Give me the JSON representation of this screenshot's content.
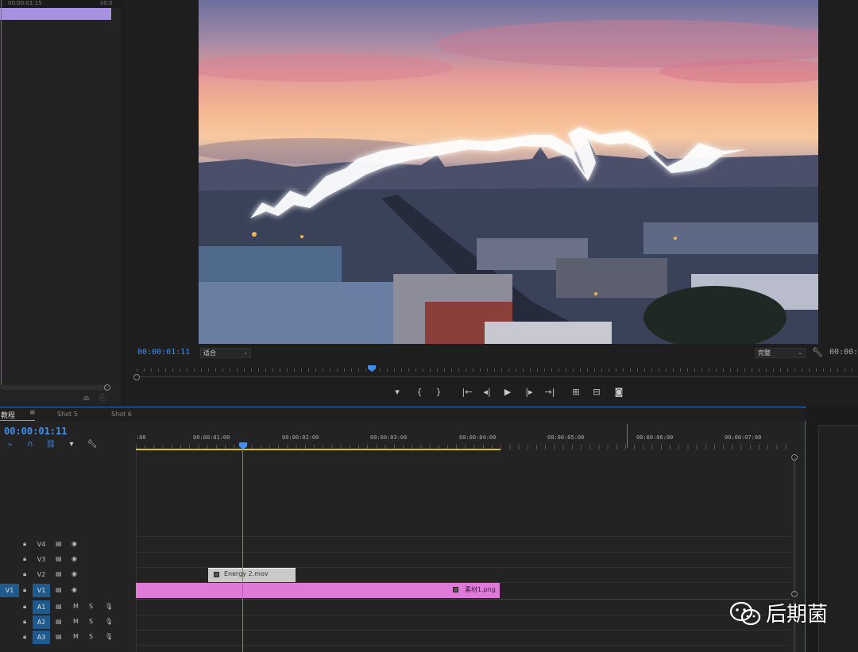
{
  "source_monitor": {
    "ruler_left": "00:00:01:15",
    "ruler_right": "00:0"
  },
  "program": {
    "timecode": "00:00:01:11",
    "fit_value": "适合",
    "quality_value": "完整",
    "duration": "00:00:",
    "transport": [
      {
        "name": "add-marker",
        "glyph": "▾"
      },
      {
        "name": "mark-in",
        "glyph": "{"
      },
      {
        "name": "mark-out",
        "glyph": "}"
      },
      {
        "name": "go-to-in",
        "glyph": "|←"
      },
      {
        "name": "step-back",
        "glyph": "◂|"
      },
      {
        "name": "play",
        "glyph": "▶"
      },
      {
        "name": "step-forward",
        "glyph": "|▸"
      },
      {
        "name": "go-to-out",
        "glyph": "→|"
      },
      {
        "name": "lift",
        "glyph": "⊞"
      },
      {
        "name": "extract",
        "glyph": "⊟"
      },
      {
        "name": "export-frame",
        "glyph": "◙"
      }
    ]
  },
  "timeline": {
    "tabs": {
      "main": "教程",
      "menu": "≡",
      "shot5": "Shot 5",
      "shot6": "Shot 6"
    },
    "timecode": "00:00:01:11",
    "ruler_labels": [
      ":00",
      "00:00:01:00",
      "00:00:02:00",
      "00:00:03:00",
      "00:00:04:00",
      "00:00:05:00",
      "00:00:06:00",
      "00:00:07:00"
    ],
    "tracks": {
      "V4": "V4",
      "V3": "V3",
      "V2": "V2",
      "V1": "V1",
      "A1": "A1",
      "A2": "A2",
      "A3": "A3",
      "source_patch_v1": "V1",
      "mute": "M",
      "solo": "S"
    },
    "clips": {
      "energy": "Energy 2.mov",
      "png": "素材1.png"
    }
  },
  "watermark": {
    "text": "后期菌"
  },
  "colors": {
    "accent": "#3e8ef0",
    "clip_png": "#e07ad9",
    "clip_energy": "#c9c9c9",
    "source_clip": "#a792e0",
    "work_area": "#d8c42c"
  }
}
